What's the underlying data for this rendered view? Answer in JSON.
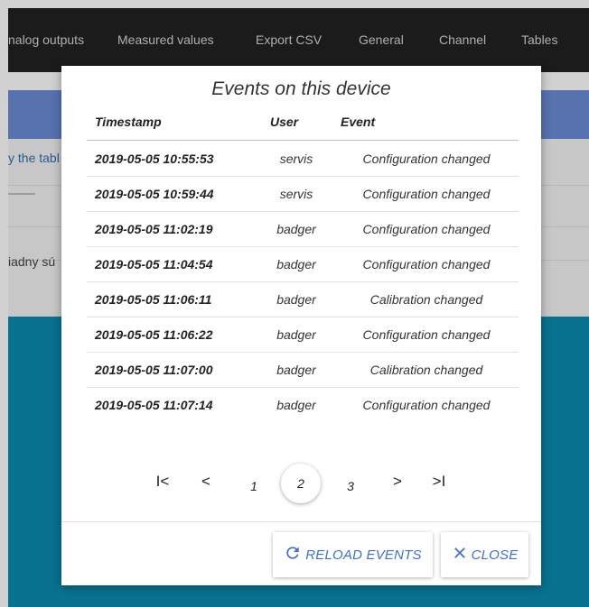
{
  "nav": {
    "items": [
      "nalog outputs",
      "Measured values",
      "Export CSV",
      "General",
      "Channel",
      "Tables"
    ]
  },
  "background": {
    "table_hint": "y the tabl",
    "empty_text": "iadny sú"
  },
  "dialog": {
    "title": "Events on this device",
    "columns": [
      "Timestamp",
      "User",
      "Event"
    ],
    "rows": [
      {
        "timestamp": "2019-05-05 10:55:53",
        "user": "servis",
        "event": "Configuration changed"
      },
      {
        "timestamp": "2019-05-05 10:59:44",
        "user": "servis",
        "event": "Configuration changed"
      },
      {
        "timestamp": "2019-05-05 11:02:19",
        "user": "badger",
        "event": "Configuration changed"
      },
      {
        "timestamp": "2019-05-05 11:04:54",
        "user": "badger",
        "event": "Configuration changed"
      },
      {
        "timestamp": "2019-05-05 11:06:11",
        "user": "badger",
        "event": "Calibration changed"
      },
      {
        "timestamp": "2019-05-05 11:06:22",
        "user": "badger",
        "event": "Configuration changed"
      },
      {
        "timestamp": "2019-05-05 11:07:00",
        "user": "badger",
        "event": "Calibration changed"
      },
      {
        "timestamp": "2019-05-05 11:07:14",
        "user": "badger",
        "event": "Configuration changed"
      }
    ],
    "pagination": {
      "first": "I<",
      "prev": "<",
      "pages": [
        "1",
        "2",
        "3"
      ],
      "current": "2",
      "next": ">",
      "last": ">I"
    },
    "buttons": {
      "reload_label": "RELOAD EVENTS",
      "close_label": "CLOSE"
    }
  },
  "colors": {
    "accent": "#3f6fd1",
    "nav_bg": "#212121",
    "teal_bg": "#0a8bb0",
    "blue_bar": "#6c8ad6"
  }
}
